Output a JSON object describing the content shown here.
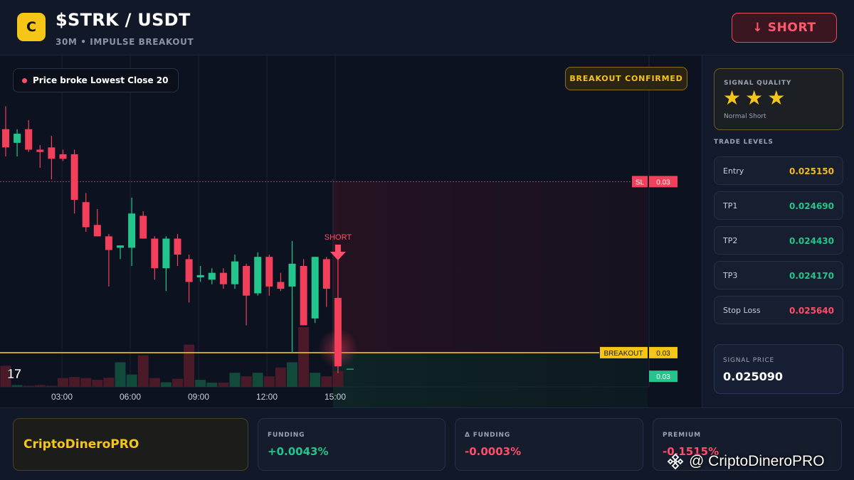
{
  "header": {
    "logo_letter": "C",
    "pair": "$STRK / USDT",
    "subtitle": "30M • IMPULSE BREAKOUT",
    "short_button": "↓ SHORT"
  },
  "chart": {
    "status_chip": "Price broke Lowest Close 20",
    "confirmed_chip": "BREAKOUT CONFIRMED",
    "short_marker": "SHORT",
    "sl_tag": "SL",
    "sl_value": "0.03",
    "breakout_tag": "BREAKOUT",
    "breakout_value": "0.03",
    "price_tag": "0.03",
    "time_labels": [
      "03:00",
      "06:00",
      "09:00",
      "12:00",
      "15:00"
    ],
    "logo_mark": "17",
    "colors": {
      "up": "#22c58b",
      "down": "#f23f5a",
      "breakout": "#f5c518"
    }
  },
  "chart_data": {
    "type": "candlestick",
    "x_labels": [
      "03:00",
      "06:00",
      "09:00",
      "12:00",
      "15:00"
    ],
    "candles": [
      {
        "o": 0.02538,
        "h": 0.02548,
        "l": 0.02526,
        "c": 0.0253
      },
      {
        "o": 0.02532,
        "h": 0.02538,
        "l": 0.02526,
        "c": 0.02536
      },
      {
        "o": 0.02538,
        "h": 0.02542,
        "l": 0.02528,
        "c": 0.02529
      },
      {
        "o": 0.02529,
        "h": 0.02531,
        "l": 0.02521,
        "c": 0.02528
      },
      {
        "o": 0.0253,
        "h": 0.02535,
        "l": 0.02516,
        "c": 0.02525
      },
      {
        "o": 0.02527,
        "h": 0.02529,
        "l": 0.02524,
        "c": 0.02525
      },
      {
        "o": 0.02527,
        "h": 0.02529,
        "l": 0.02501,
        "c": 0.02507
      },
      {
        "o": 0.02506,
        "h": 0.0251,
        "l": 0.02493,
        "c": 0.02495
      },
      {
        "o": 0.02496,
        "h": 0.02503,
        "l": 0.02491,
        "c": 0.02491
      },
      {
        "o": 0.02491,
        "h": 0.02492,
        "l": 0.02469,
        "c": 0.02485
      },
      {
        "o": 0.02486,
        "h": 0.02487,
        "l": 0.02481,
        "c": 0.02487
      },
      {
        "o": 0.02486,
        "h": 0.02508,
        "l": 0.02478,
        "c": 0.02501
      },
      {
        "o": 0.025,
        "h": 0.02502,
        "l": 0.0249,
        "c": 0.0249
      },
      {
        "o": 0.0249,
        "h": 0.02491,
        "l": 0.02472,
        "c": 0.02477
      },
      {
        "o": 0.02477,
        "h": 0.02491,
        "l": 0.02467,
        "c": 0.0249
      },
      {
        "o": 0.0249,
        "h": 0.02492,
        "l": 0.02478,
        "c": 0.02483
      },
      {
        "o": 0.02481,
        "h": 0.02483,
        "l": 0.02462,
        "c": 0.02471
      },
      {
        "o": 0.02473,
        "h": 0.02478,
        "l": 0.02471,
        "c": 0.02474
      },
      {
        "o": 0.02472,
        "h": 0.02477,
        "l": 0.0247,
        "c": 0.02475
      },
      {
        "o": 0.02475,
        "h": 0.02477,
        "l": 0.02468,
        "c": 0.0247
      },
      {
        "o": 0.0247,
        "h": 0.02483,
        "l": 0.02468,
        "c": 0.0248
      },
      {
        "o": 0.02478,
        "h": 0.02479,
        "l": 0.02452,
        "c": 0.02465
      },
      {
        "o": 0.02466,
        "h": 0.02484,
        "l": 0.02465,
        "c": 0.02482
      },
      {
        "o": 0.02482,
        "h": 0.02483,
        "l": 0.02465,
        "c": 0.02469
      },
      {
        "o": 0.02471,
        "h": 0.02475,
        "l": 0.02467,
        "c": 0.02468
      },
      {
        "o": 0.02469,
        "h": 0.02489,
        "l": 0.0244,
        "c": 0.02479
      },
      {
        "o": 0.02478,
        "h": 0.02481,
        "l": 0.02452,
        "c": 0.02452
      },
      {
        "o": 0.02455,
        "h": 0.02482,
        "l": 0.02453,
        "c": 0.02482
      },
      {
        "o": 0.02481,
        "h": 0.02482,
        "l": 0.0246,
        "c": 0.02468
      },
      {
        "o": 0.02464,
        "h": 0.02486,
        "l": 0.02431,
        "c": 0.02434
      }
    ],
    "volume": [
      6,
      0.5,
      0.3,
      0.5,
      0.3,
      2.5,
      2.8,
      2.5,
      2,
      2.6,
      7,
      3.5,
      9,
      2.5,
      1.3,
      2.3,
      12,
      2,
      1.2,
      1.2,
      4,
      3,
      4,
      3,
      5.5,
      7,
      17,
      4,
      3,
      4.5
    ],
    "levels": {
      "sl": 0.02515,
      "breakout": 0.0244
    },
    "ylim": [
      0.02425,
      0.0257
    ],
    "signal_index": 29
  },
  "side": {
    "quality_label": "SIGNAL QUALITY",
    "stars": [
      "★",
      "★",
      "★"
    ],
    "quality_note": "Normal Short",
    "levels_title": "TRADE LEVELS",
    "levels": [
      {
        "name": "Entry",
        "value": "0.025150",
        "color": "#f5b81c"
      },
      {
        "name": "TP1",
        "value": "0.024690",
        "color": "#22c58b"
      },
      {
        "name": "TP2",
        "value": "0.024430",
        "color": "#22c58b"
      },
      {
        "name": "TP3",
        "value": "0.024170",
        "color": "#22c58b"
      },
      {
        "name": "Stop Loss",
        "value": "0.025640",
        "color": "#ff4d6a"
      }
    ],
    "signal_label": "SIGNAL PRICE",
    "signal_value": "0.025090"
  },
  "footer": {
    "brand": "CriptoDineroPRO",
    "metrics": [
      {
        "label": "FUNDING",
        "value": "+0.0043%",
        "color": "#22c58b"
      },
      {
        "label": "Δ FUNDING",
        "value": "-0.0003%",
        "color": "#ff4d6a"
      },
      {
        "label": "PREMIUM",
        "value": "-0.1515%",
        "color": "#ff4d6a"
      }
    ],
    "watermark": "@ CriptoDineroPRO"
  }
}
